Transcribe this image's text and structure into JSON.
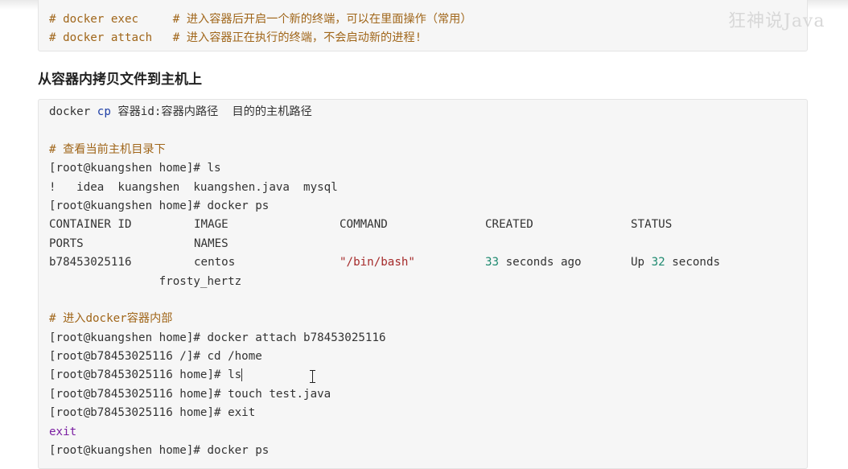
{
  "watermark": "狂神说Java",
  "top_block": {
    "line1_cmd": "# docker exec",
    "line1_comment": "# 进入容器后开启一个新的终端，可以在里面操作（常用）",
    "line2_cmd": "# docker attach",
    "line2_comment": "# 进入容器正在执行的终端，不会启动新的进程!"
  },
  "heading": "从容器内拷贝文件到主机上",
  "code": {
    "cp_pre": "docker ",
    "cp_kw": "cp",
    "cp_rest": " 容器id:容器内路径  目的的主机路径",
    "comment_check": "# 查看当前主机目录下",
    "prompt_host": "[root@kuangshen home]# ",
    "cmd_ls": "ls",
    "ls_output": "!   idea  kuangshen  kuangshen.java  mysql",
    "cmd_docker_ps": "docker ps",
    "ps_headers": [
      "CONTAINER ID",
      "IMAGE",
      "COMMAND",
      "CREATED",
      "STATUS"
    ],
    "ps_headers2": [
      "PORTS",
      "NAMES"
    ],
    "ps_row": {
      "id": "b78453025116",
      "image": "centos",
      "command": "\"/bin/bash\"",
      "created_num": "33",
      "created_rest": " seconds ago",
      "status_pre": "Up ",
      "status_num": "32",
      "status_rest": " seconds"
    },
    "ps_names": "frosty_hertz",
    "comment_enter": "# 进入docker容器内部",
    "cmd_attach": "docker attach b78453025116",
    "prompt_c_root": "[root@b78453025116 /]# ",
    "cmd_cd": "cd /home",
    "prompt_c_home": "[root@b78453025116 home]# ",
    "cmd_touch": "touch test.java",
    "cmd_exit": "exit",
    "exit_output": "exit"
  }
}
